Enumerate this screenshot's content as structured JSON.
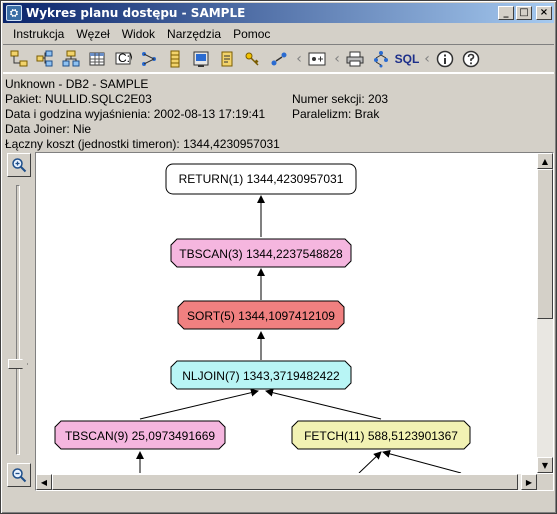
{
  "window": {
    "title": "Wykres planu dostępu - SAMPLE",
    "app_icon": "db2-icon",
    "buttons": [
      "_",
      "□",
      "×"
    ]
  },
  "menu": [
    "Instrukcja",
    "Węzeł",
    "Widok",
    "Narzędzia",
    "Pomoc"
  ],
  "toolbar": {
    "icons": [
      "node-tree-icon",
      "node-expand-icon",
      "node-collapse-icon",
      "table-icon",
      "command-icon",
      "graph-layout-icon",
      "column-icon",
      "index-icon",
      "statistics-icon",
      "key-icon",
      "connection-icon",
      "back-icon",
      "plan-details-icon",
      "print-icon",
      "tree-icon",
      "info-icon",
      "help-icon"
    ],
    "sql_label": "SQL",
    "separator": "‹"
  },
  "info": {
    "line1": "Unknown - DB2 - SAMPLE",
    "package": "Pakiet: NULLID.SQLC2E03",
    "section": "Numer sekcji: 203",
    "explain_date": "Data i godzina wyjaśnienia: 2002-08-13 17:19:41",
    "parallelism": "Paralelizm: Brak",
    "data_joiner": "Data Joiner: Nie",
    "total_cost": "Łączny koszt (jednostki timeron): 1344,4230957031"
  },
  "zoom": {
    "zoom_in_icon": "zoom-in-icon",
    "zoom_out_icon": "zoom-out-icon",
    "level": 0.77
  },
  "plan_nodes": [
    {
      "id": "return",
      "label": "RETURN(1) 1344,4230957031",
      "fill": "#ffffff",
      "shape": "rounded"
    },
    {
      "id": "tbscan3",
      "label": "TBSCAN(3) 1344,2237548828",
      "fill": "#f5b6df",
      "shape": "octagon"
    },
    {
      "id": "sort5",
      "label": "SORT(5) 1344,1097412109",
      "fill": "#f08080",
      "shape": "octagon"
    },
    {
      "id": "nljoin7",
      "label": "NLJOIN(7) 1343,3719482422",
      "fill": "#b8f5f5",
      "shape": "octagon"
    },
    {
      "id": "tbscan9",
      "label": "TBSCAN(9) 25,0973491669",
      "fill": "#f5b6df",
      "shape": "octagon"
    },
    {
      "id": "fetch11",
      "label": "FETCH(11) 588,5123901367",
      "fill": "#f2f2b3",
      "shape": "octagon"
    }
  ],
  "colors": {
    "title_start": "#0a246a",
    "title_end": "#a6caf0",
    "face": "#d4d0c8"
  }
}
